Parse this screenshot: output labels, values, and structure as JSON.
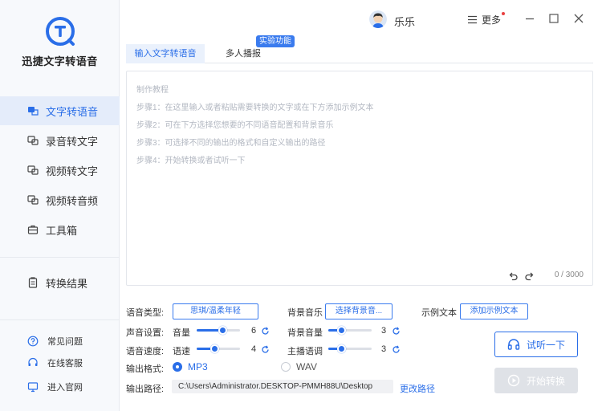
{
  "app": {
    "name": "迅捷文字转语音"
  },
  "colors": {
    "accent": "#2a6ee8",
    "sidebar_bg": "#f7f9fc",
    "active_bg": "#e4ecfa",
    "badge_dot": "#e94040"
  },
  "sidebar": {
    "items": [
      {
        "label": "文字转语音",
        "icon": "text-to-speech-icon",
        "active": true
      },
      {
        "label": "录音转文字",
        "icon": "recording-to-text-icon",
        "active": false
      },
      {
        "label": "视频转文字",
        "icon": "video-to-text-icon",
        "active": false
      },
      {
        "label": "视频转音频",
        "icon": "video-to-audio-icon",
        "active": false
      },
      {
        "label": "工具箱",
        "icon": "toolbox-icon",
        "active": false
      }
    ],
    "result": {
      "label": "转换结果",
      "icon": "clipboard-icon"
    },
    "footer": [
      {
        "label": "常见问题",
        "icon": "help-icon"
      },
      {
        "label": "在线客服",
        "icon": "headset-icon"
      },
      {
        "label": "进入官网",
        "icon": "monitor-icon"
      }
    ]
  },
  "titlebar": {
    "username": "乐乐",
    "more_label": "更多"
  },
  "tabs": [
    {
      "label": "输入文字转语音",
      "active": true
    },
    {
      "label": "多人播报",
      "active": false
    }
  ],
  "badge": "实验功能",
  "editor": {
    "placeholder_lines": [
      "制作教程",
      "步骤1：在这里输入或者粘贴需要转换的文字或在下方添加示例文本",
      "步骤2：可在下方选择您想要的不同语音配置和背景音乐",
      "步骤3：可选择不同的输出的格式和自定义输出的路径",
      "步骤4：开始转换或者试听一下"
    ],
    "char_count": "0 / 3000"
  },
  "settings": {
    "voice_type_label": "语音类型:",
    "voice_type_value": "思琪/温柔年轻",
    "bgm_label": "背景音乐",
    "bgm_button": "选择背景音...",
    "sample_label": "示例文本",
    "sample_button": "添加示例文本",
    "sound_label": "声音设置:",
    "volume_label": "音量",
    "volume_value": "6",
    "volume_max": 10,
    "bg_volume_label": "背景音量",
    "bg_volume_value": "3",
    "bg_volume_max": 10,
    "speed_label": "语音速度:",
    "speed_sub_label": "语速",
    "speed_value": "4",
    "speed_max": 10,
    "tone_label": "主播语调",
    "tone_value": "3",
    "tone_max": 10,
    "format_label": "输出格式:",
    "formats": [
      {
        "label": "MP3",
        "checked": true
      },
      {
        "label": "WAV",
        "checked": false
      }
    ],
    "path_label": "输出路径:",
    "path_value": "C:\\Users\\Administrator.DESKTOP-PMMH88U\\Desktop",
    "change_path": "更改路径"
  },
  "actions": {
    "listen": "试听一下",
    "start": "开始转换"
  }
}
